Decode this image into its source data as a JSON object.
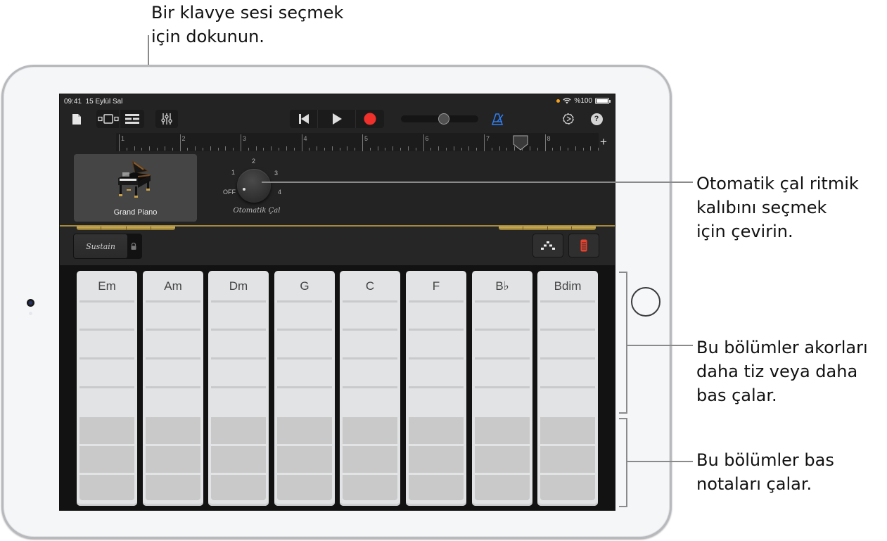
{
  "callouts": {
    "top": "Bir klavye sesi seçmek\niçin dokunun.",
    "autoplay": "Otomatik çal ritmik\nkalıbını seçmek\niçin çevirin.",
    "chords": "Bu bölümler akorları\ndaha tiz veya daha\nbas çalar.",
    "bass": "Bu bölümler bas\nnotaları çalar."
  },
  "statusbar": {
    "time": "09:41",
    "date": "15 Eylül Sal",
    "battery": "%100"
  },
  "toolbar": {
    "icons": [
      "document-icon",
      "track-view-icon",
      "tracks-list-icon",
      "mixer-icon",
      "go-to-beginning-icon",
      "play-icon",
      "record-icon",
      "metronome-icon",
      "settings-icon",
      "help-icon"
    ],
    "help_label": "?",
    "volume_level": 0.55
  },
  "ruler": {
    "bars": [
      "1",
      "2",
      "3",
      "4",
      "5",
      "6",
      "7",
      "8"
    ],
    "add_label": "+",
    "playhead_bar": 7.6
  },
  "instrument": {
    "name": "Grand Piano"
  },
  "autoplay": {
    "title": "Otomatik Çal",
    "positions": [
      "OFF",
      "1",
      "2",
      "3",
      "4"
    ],
    "selected": "OFF"
  },
  "controls": {
    "sustain_label": "Sustain",
    "arpeggiator": "arpeggiator-icon",
    "keyboard_toggle": "chord-strips-icon"
  },
  "chord_strips": [
    {
      "chord": "Em"
    },
    {
      "chord": "Am"
    },
    {
      "chord": "Dm"
    },
    {
      "chord": "G"
    },
    {
      "chord": "C"
    },
    {
      "chord": "F"
    },
    {
      "chord": "B♭"
    },
    {
      "chord": "Bdim"
    }
  ],
  "colors": {
    "record": "#f0302a",
    "metronome": "#2f7ff5",
    "accent_gold": "#c9ad58",
    "toggle_red": "#e8412d"
  }
}
